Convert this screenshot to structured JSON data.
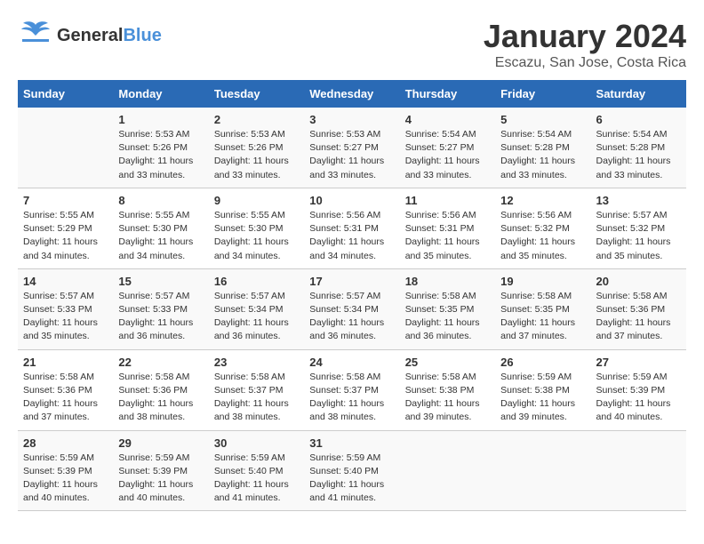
{
  "header": {
    "logo_general": "General",
    "logo_blue": "Blue",
    "title": "January 2024",
    "subtitle": "Escazu, San Jose, Costa Rica"
  },
  "weekdays": [
    "Sunday",
    "Monday",
    "Tuesday",
    "Wednesday",
    "Thursday",
    "Friday",
    "Saturday"
  ],
  "weeks": [
    [
      {
        "day": "",
        "info": ""
      },
      {
        "day": "1",
        "info": "Sunrise: 5:53 AM\nSunset: 5:26 PM\nDaylight: 11 hours\nand 33 minutes."
      },
      {
        "day": "2",
        "info": "Sunrise: 5:53 AM\nSunset: 5:26 PM\nDaylight: 11 hours\nand 33 minutes."
      },
      {
        "day": "3",
        "info": "Sunrise: 5:53 AM\nSunset: 5:27 PM\nDaylight: 11 hours\nand 33 minutes."
      },
      {
        "day": "4",
        "info": "Sunrise: 5:54 AM\nSunset: 5:27 PM\nDaylight: 11 hours\nand 33 minutes."
      },
      {
        "day": "5",
        "info": "Sunrise: 5:54 AM\nSunset: 5:28 PM\nDaylight: 11 hours\nand 33 minutes."
      },
      {
        "day": "6",
        "info": "Sunrise: 5:54 AM\nSunset: 5:28 PM\nDaylight: 11 hours\nand 33 minutes."
      }
    ],
    [
      {
        "day": "7",
        "info": "Sunrise: 5:55 AM\nSunset: 5:29 PM\nDaylight: 11 hours\nand 34 minutes."
      },
      {
        "day": "8",
        "info": "Sunrise: 5:55 AM\nSunset: 5:30 PM\nDaylight: 11 hours\nand 34 minutes."
      },
      {
        "day": "9",
        "info": "Sunrise: 5:55 AM\nSunset: 5:30 PM\nDaylight: 11 hours\nand 34 minutes."
      },
      {
        "day": "10",
        "info": "Sunrise: 5:56 AM\nSunset: 5:31 PM\nDaylight: 11 hours\nand 34 minutes."
      },
      {
        "day": "11",
        "info": "Sunrise: 5:56 AM\nSunset: 5:31 PM\nDaylight: 11 hours\nand 35 minutes."
      },
      {
        "day": "12",
        "info": "Sunrise: 5:56 AM\nSunset: 5:32 PM\nDaylight: 11 hours\nand 35 minutes."
      },
      {
        "day": "13",
        "info": "Sunrise: 5:57 AM\nSunset: 5:32 PM\nDaylight: 11 hours\nand 35 minutes."
      }
    ],
    [
      {
        "day": "14",
        "info": "Sunrise: 5:57 AM\nSunset: 5:33 PM\nDaylight: 11 hours\nand 35 minutes."
      },
      {
        "day": "15",
        "info": "Sunrise: 5:57 AM\nSunset: 5:33 PM\nDaylight: 11 hours\nand 36 minutes."
      },
      {
        "day": "16",
        "info": "Sunrise: 5:57 AM\nSunset: 5:34 PM\nDaylight: 11 hours\nand 36 minutes."
      },
      {
        "day": "17",
        "info": "Sunrise: 5:57 AM\nSunset: 5:34 PM\nDaylight: 11 hours\nand 36 minutes."
      },
      {
        "day": "18",
        "info": "Sunrise: 5:58 AM\nSunset: 5:35 PM\nDaylight: 11 hours\nand 36 minutes."
      },
      {
        "day": "19",
        "info": "Sunrise: 5:58 AM\nSunset: 5:35 PM\nDaylight: 11 hours\nand 37 minutes."
      },
      {
        "day": "20",
        "info": "Sunrise: 5:58 AM\nSunset: 5:36 PM\nDaylight: 11 hours\nand 37 minutes."
      }
    ],
    [
      {
        "day": "21",
        "info": "Sunrise: 5:58 AM\nSunset: 5:36 PM\nDaylight: 11 hours\nand 37 minutes."
      },
      {
        "day": "22",
        "info": "Sunrise: 5:58 AM\nSunset: 5:36 PM\nDaylight: 11 hours\nand 38 minutes."
      },
      {
        "day": "23",
        "info": "Sunrise: 5:58 AM\nSunset: 5:37 PM\nDaylight: 11 hours\nand 38 minutes."
      },
      {
        "day": "24",
        "info": "Sunrise: 5:58 AM\nSunset: 5:37 PM\nDaylight: 11 hours\nand 38 minutes."
      },
      {
        "day": "25",
        "info": "Sunrise: 5:58 AM\nSunset: 5:38 PM\nDaylight: 11 hours\nand 39 minutes."
      },
      {
        "day": "26",
        "info": "Sunrise: 5:59 AM\nSunset: 5:38 PM\nDaylight: 11 hours\nand 39 minutes."
      },
      {
        "day": "27",
        "info": "Sunrise: 5:59 AM\nSunset: 5:39 PM\nDaylight: 11 hours\nand 40 minutes."
      }
    ],
    [
      {
        "day": "28",
        "info": "Sunrise: 5:59 AM\nSunset: 5:39 PM\nDaylight: 11 hours\nand 40 minutes."
      },
      {
        "day": "29",
        "info": "Sunrise: 5:59 AM\nSunset: 5:39 PM\nDaylight: 11 hours\nand 40 minutes."
      },
      {
        "day": "30",
        "info": "Sunrise: 5:59 AM\nSunset: 5:40 PM\nDaylight: 11 hours\nand 41 minutes."
      },
      {
        "day": "31",
        "info": "Sunrise: 5:59 AM\nSunset: 5:40 PM\nDaylight: 11 hours\nand 41 minutes."
      },
      {
        "day": "",
        "info": ""
      },
      {
        "day": "",
        "info": ""
      },
      {
        "day": "",
        "info": ""
      }
    ]
  ]
}
